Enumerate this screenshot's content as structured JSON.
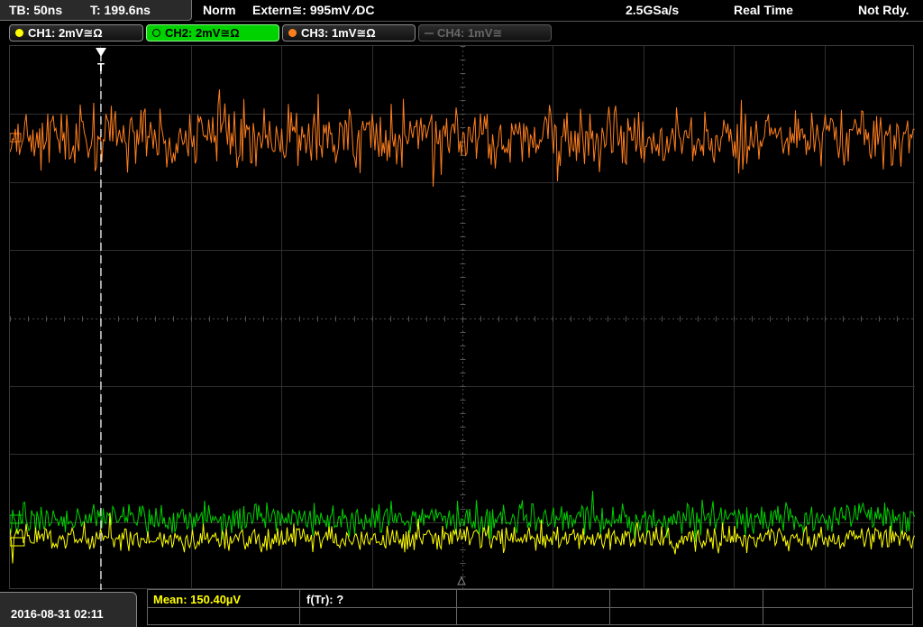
{
  "header": {
    "timebase": "TB: 50ns",
    "trigger_time": "T: 199.6ns",
    "mode": "Norm",
    "trigger_source": "Extern≅: 995mV ⁄DC",
    "sample_rate": "2.5GSa/s",
    "acquisition": "Real Time",
    "status": "Not Rdy."
  },
  "channels": [
    {
      "label": "CH1: 2mV≅Ω",
      "color": "#ffff00",
      "state": "on"
    },
    {
      "label": "CH2: 2mV≅Ω",
      "color": "#00d200",
      "state": "selected"
    },
    {
      "label": "CH3: 1mV≅Ω",
      "color": "#ff7f1e",
      "state": "on"
    },
    {
      "label": "CH4: 1mV≅",
      "color": "#666666",
      "state": "off"
    }
  ],
  "trigger_marker": "T",
  "footer": {
    "datetime": "2016-08-31 02:11",
    "measurements": [
      {
        "label": "Mean: 150.40µV",
        "color": "#ffff00"
      },
      {
        "label": "f(Tr): ?",
        "color": "#ffffff"
      }
    ]
  },
  "colors": {
    "ch1": "#ffff00",
    "ch2": "#00d200",
    "ch3": "#ff7f1e",
    "grid": "#3a3a3a"
  }
}
